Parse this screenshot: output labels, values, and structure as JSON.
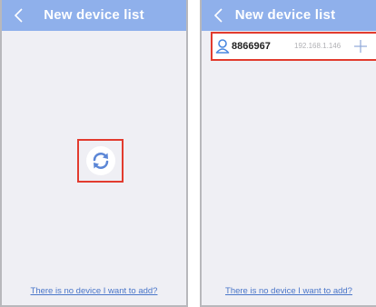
{
  "screens": [
    {
      "title": "New device list",
      "no_device_link": "There is no device I want to add?"
    },
    {
      "title": "New device list",
      "no_device_link": "There is no device I want to add?",
      "devices": [
        {
          "id": "8866967",
          "ip": "192.168.1.146"
        }
      ]
    }
  ],
  "colors": {
    "navbar": "#8fb0eb",
    "accent": "#4a76c9",
    "highlight": "#e23b2e",
    "background": "#efeff4"
  },
  "icons": {
    "back": "chevron-left-icon",
    "refresh": "refresh-icon",
    "device": "user-icon",
    "add": "plus-icon"
  }
}
